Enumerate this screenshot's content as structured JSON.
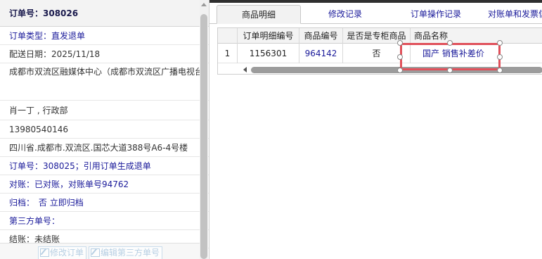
{
  "order_info": {
    "order_no": "订单号：308026",
    "order_type": "订单类型：直发退单",
    "delivery_date": "配送日期：2025/11/18",
    "address_line": "成都市双流区融媒体中心（成都市双流区广播电视台）",
    "contact": "肖一丁 , 行政部",
    "phone": "13980540146",
    "region_address": "四川省.成都市.双流区.国芯大道388号A6-4号楼",
    "ref_order": "订单号：308025；引用订单生成退单",
    "reconcile": "对账：已对账，对账单号94762",
    "archive_label": "归档：",
    "archive_value": "否",
    "archive_action": "立即归档",
    "third_party_no": "第三方单号：",
    "settlement": "结账：未结账"
  },
  "actions": {
    "edit_order": "修改订单",
    "edit_third_party": "编辑第三方单号"
  },
  "tabs": [
    {
      "label": "商品明细",
      "active": true
    },
    {
      "label": "修改记录",
      "active": false
    },
    {
      "label": "订单操作记录",
      "active": false
    },
    {
      "label": "对账单和发票信",
      "active": false
    }
  ],
  "grid": {
    "headers": [
      "",
      "订单明细编号",
      "商品编号",
      "是否是专柜商品",
      "商品名称"
    ],
    "rows": [
      {
        "index": "1",
        "detail_no": "1156301",
        "product_no": "964142",
        "is_counter": "否",
        "product_name": "国产 销售补差价"
      }
    ]
  },
  "colors": {
    "link": "#1a1a9a",
    "selection": "#e0505a"
  }
}
